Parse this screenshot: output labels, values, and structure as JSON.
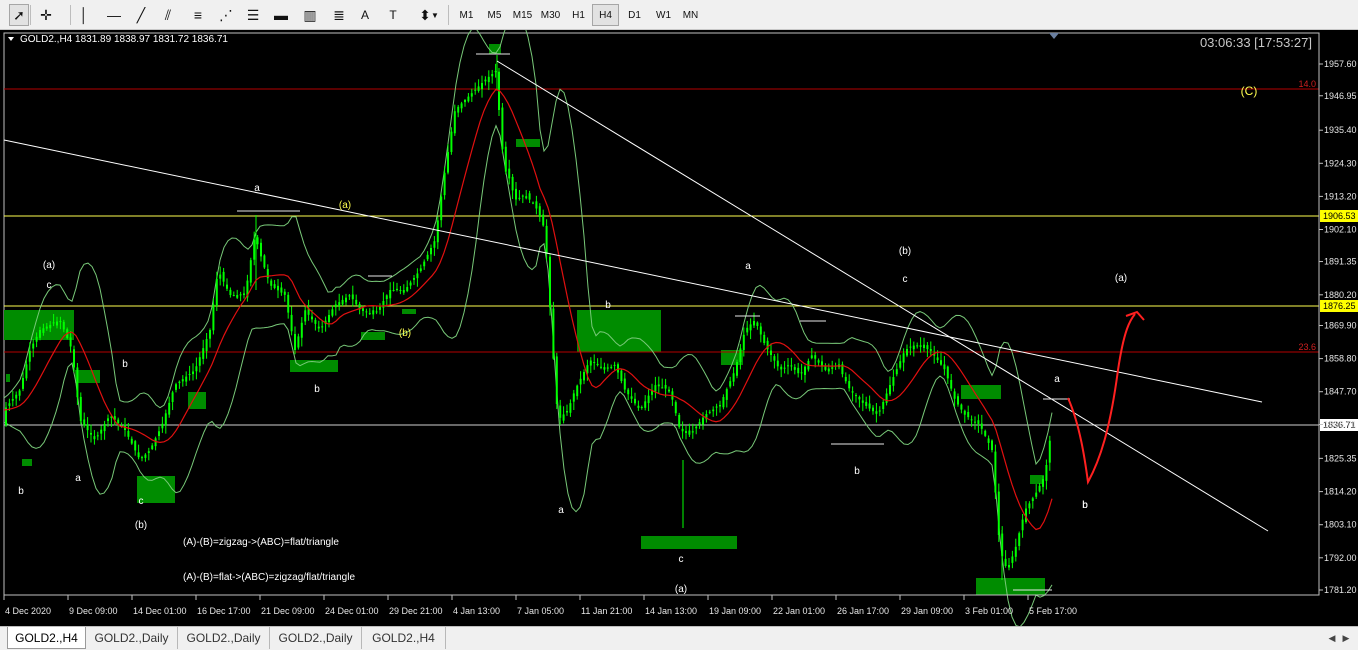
{
  "toolbar": {
    "tools": [
      {
        "name": "cursor-icon",
        "glyph": "➚"
      },
      {
        "name": "crosshair-icon",
        "glyph": "✛"
      },
      {
        "name": "vertical-line-icon",
        "glyph": "│"
      },
      {
        "name": "horizontal-line-icon",
        "glyph": "—"
      },
      {
        "name": "trendline-icon",
        "glyph": "╱"
      },
      {
        "name": "channel-icon",
        "glyph": "⫽"
      },
      {
        "name": "gann-fan-icon",
        "glyph": "≡"
      },
      {
        "name": "fibonacci-fan-icon",
        "glyph": "⋰"
      },
      {
        "name": "fibonacci-retracement-icon",
        "glyph": "☰"
      },
      {
        "name": "rectangle-icon",
        "glyph": "▬"
      },
      {
        "name": "elliott-wave-icon",
        "glyph": "▥"
      },
      {
        "name": "fibonacci-levels-icon",
        "glyph": "≣"
      },
      {
        "name": "text-icon",
        "glyph": "A"
      },
      {
        "name": "text-label-icon",
        "glyph": "T"
      },
      {
        "name": "arrows-icon",
        "glyph": "⬍"
      }
    ],
    "timeframes": [
      "M1",
      "M5",
      "M15",
      "M30",
      "H1",
      "H4",
      "D1",
      "W1",
      "MN"
    ],
    "active_timeframe": "H4"
  },
  "chart": {
    "header": "GOLD2.,H4  1831.89 1838.97 1831.72 1836.71",
    "clock": "03:06:33 [17:53:27]",
    "price_axis": [
      "1957.60",
      "1946.95",
      "1935.40",
      "1924.30",
      "1913.20",
      "1902.10",
      "1891.35",
      "1880.20",
      "1869.90",
      "1858.80",
      "1847.70",
      "1836.71",
      "1825.35",
      "1814.20",
      "1803.10",
      "1792.00",
      "1781.20"
    ],
    "price_tags": [
      {
        "label": "1906.53",
        "bg": "#ffff00",
        "fg": "#000000"
      },
      {
        "label": "1876.25",
        "bg": "#ffff00",
        "fg": "#000000"
      },
      {
        "label": "1836.71",
        "bg": "#ffffff",
        "fg": "#000000"
      }
    ],
    "level_labels": {
      "fib_14": "14.0",
      "fib_23": "23.6"
    },
    "time_axis": [
      "4 Dec 2020",
      "9 Dec 09:00",
      "14 Dec 01:00",
      "16 Dec 17:00",
      "21 Dec 09:00",
      "24 Dec 01:00",
      "29 Dec 21:00",
      "4 Jan 13:00",
      "7 Jan 05:00",
      "11 Jan 21:00",
      "14 Jan 13:00",
      "19 Jan 09:00",
      "22 Jan 01:00",
      "26 Jan 17:00",
      "29 Jan 09:00",
      "3 Feb 01:00",
      "5 Feb 17:00"
    ],
    "wave_labels": [
      "(a)",
      "c",
      "b",
      "b",
      "a",
      "c",
      "(b)",
      "a",
      "(a)",
      "b",
      "(b)",
      "b",
      "(C)",
      "a",
      "c",
      "(a)",
      "a",
      "b",
      "(b)",
      "c",
      "b",
      "(a)",
      "a",
      "b"
    ],
    "notes": [
      "(A)-(B)=zigzag->(ABC)=flat/triangle",
      "(A)-(B)=flat->(ABC)=zigzag/flat/triangle"
    ],
    "colors": {
      "background": "#000000",
      "candle": "#00ff00",
      "bands": "#78c878",
      "ma": "#e01010",
      "trendline": "#ffffff",
      "level_yellow": "#ffff50",
      "level_red": "#b40000",
      "zone": "#008c00",
      "projection": "#ff2020"
    }
  },
  "tabs": [
    "GOLD2.,H4",
    "GOLD2.,Daily",
    "GOLD2.,Daily",
    "GOLD2.,Daily",
    "GOLD2.,H4"
  ],
  "active_tab": 0
}
